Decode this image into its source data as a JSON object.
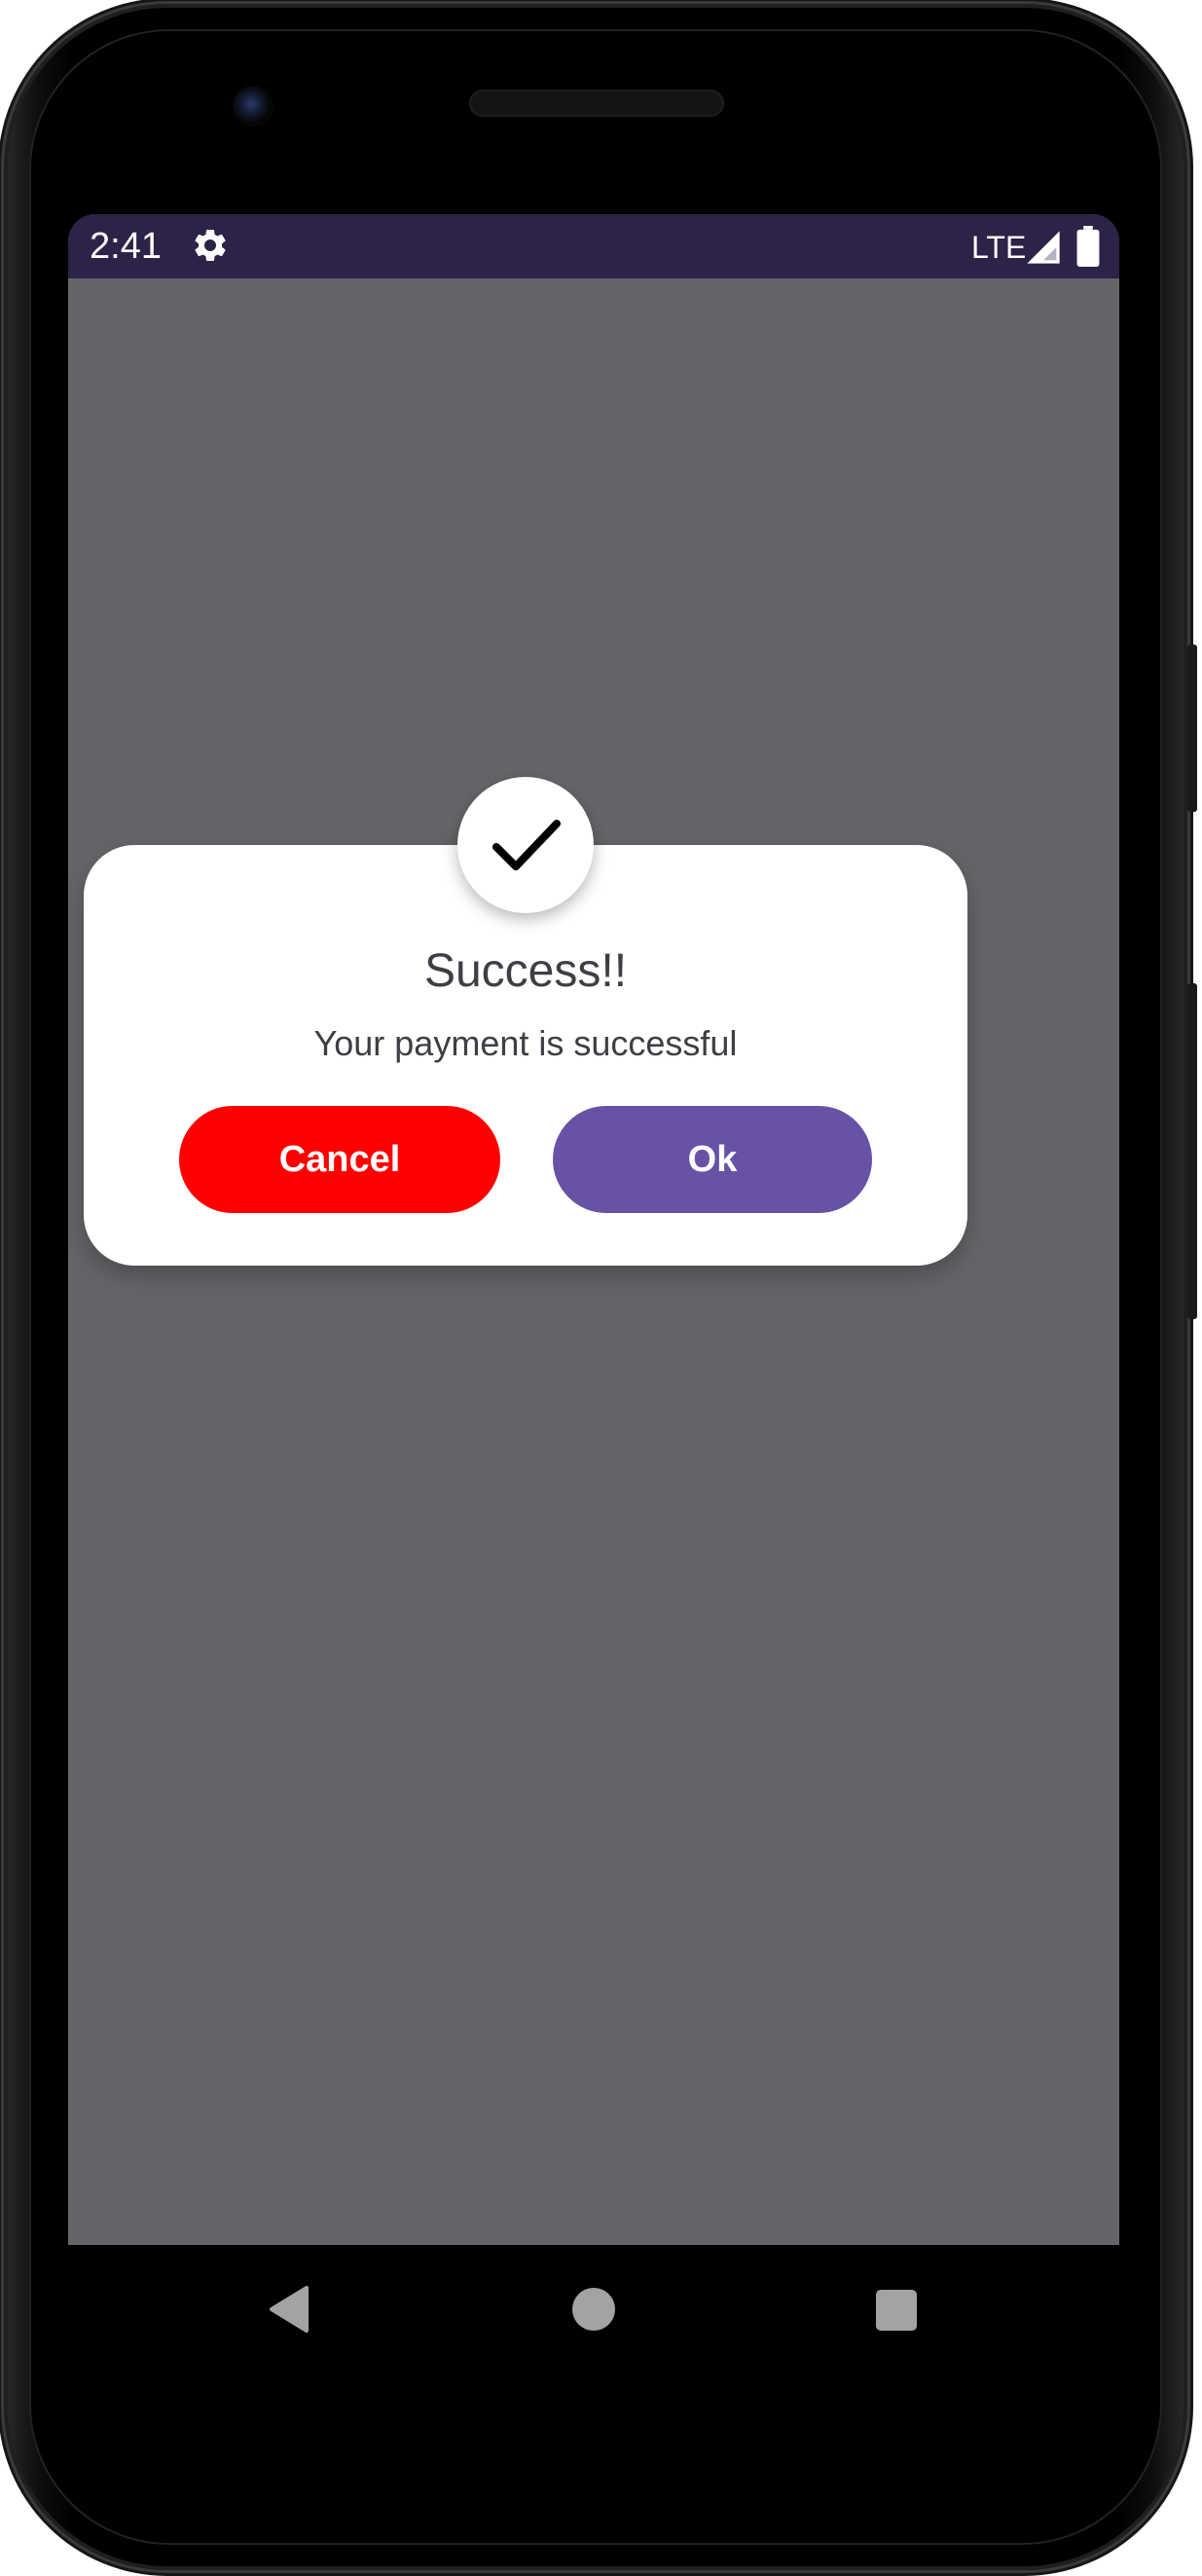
{
  "status_bar": {
    "time": "2:41",
    "network": "LTE",
    "settings_icon": "gear-icon",
    "signal_icon": "signal-icon",
    "battery_icon": "battery-icon",
    "background_color": "#2d2247"
  },
  "screen": {
    "background_color": "#666468"
  },
  "dialog": {
    "icon": "checkmark-icon",
    "title": "Success!!",
    "message": "Your payment is successful",
    "cancel_label": "Cancel",
    "ok_label": "Ok",
    "cancel_color": "#ff0000",
    "ok_color": "#6752a6"
  },
  "nav_bar": {
    "back_icon": "back-icon",
    "home_icon": "home-icon",
    "recents_icon": "recents-icon"
  }
}
